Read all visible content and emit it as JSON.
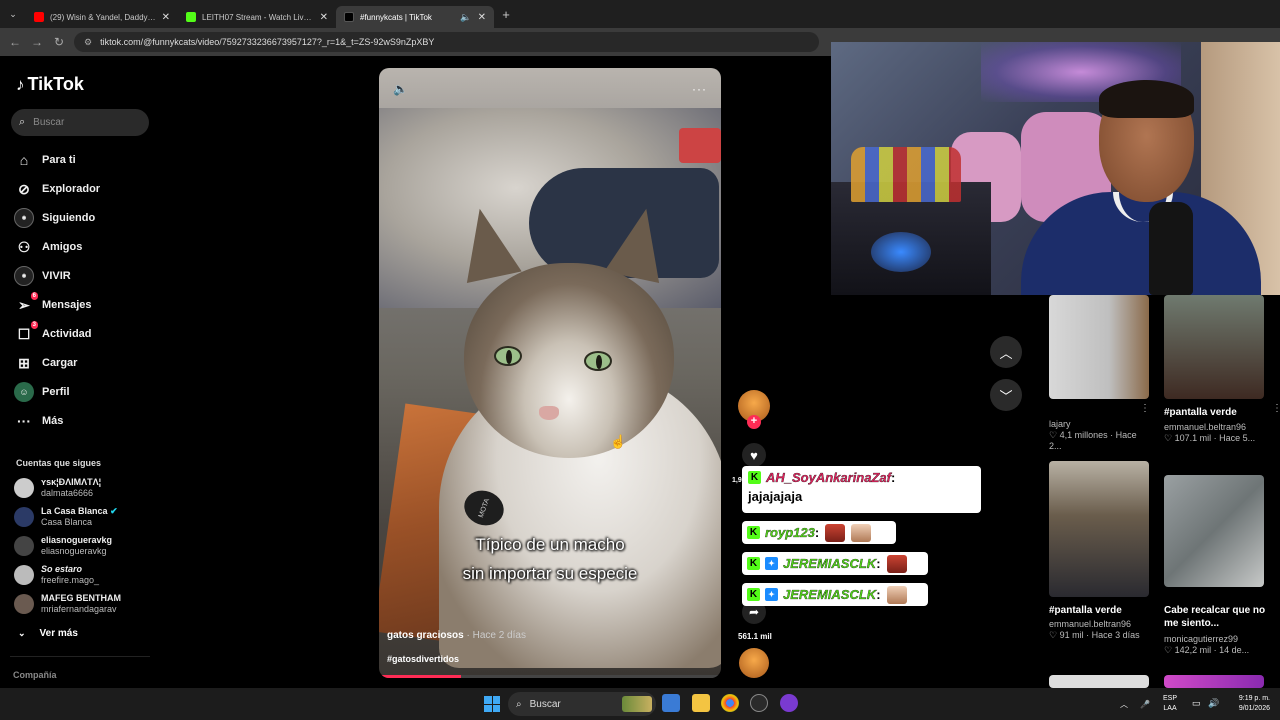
{
  "browser": {
    "tabs": [
      {
        "title": "(29) Wisin & Yandel, Daddy Yan",
        "favicon_color": "#ff0000",
        "active": false
      },
      {
        "title": "LEITH07 Stream - Watch Live o",
        "favicon_color": "#53fc18",
        "active": false
      },
      {
        "title": "#funnykcats | TikTok",
        "favicon_color": "#000000",
        "active": true
      }
    ],
    "new_tab_label": "+",
    "url": "tiktok.com/@funnykcats/video/7592733236673957127?_r=1&_t=ZS-92wS9nZpXBY"
  },
  "tiktok": {
    "logo": "TikTok",
    "search_placeholder": "Buscar",
    "nav": [
      {
        "label": "Para ti",
        "icon": "home-icon"
      },
      {
        "label": "Explorador",
        "icon": "compass-icon"
      },
      {
        "label": "Siguiendo",
        "icon": "following-icon"
      },
      {
        "label": "Amigos",
        "icon": "friends-icon"
      },
      {
        "label": "VIVIR",
        "icon": "live-icon"
      },
      {
        "label": "Mensajes",
        "icon": "messages-icon",
        "badge": "6"
      },
      {
        "label": "Actividad",
        "icon": "activity-icon",
        "badge": "3"
      },
      {
        "label": "Cargar",
        "icon": "upload-icon"
      },
      {
        "label": "Perfil",
        "icon": "profile-icon"
      },
      {
        "label": "Más",
        "icon": "more-icon"
      }
    ],
    "following_title": "Cuentas que sigues",
    "following": [
      {
        "name": "ʏsᴋ¦ĐΛIMΛTΛ¦",
        "handle": "dalmata6666"
      },
      {
        "name": "La Casa Blanca",
        "handle": "Casa Blanca",
        "verified": true
      },
      {
        "name": "eliasnogueravkg",
        "handle": "eliasnogueravkg"
      },
      {
        "name": "So estaro",
        "handle": "freefire.mago_"
      },
      {
        "name": "MAFEG BENTHAM",
        "handle": "mriafernandagarav"
      }
    ],
    "see_more": "Ver más",
    "company": "Compañía"
  },
  "video": {
    "caption_line1": "Típico de un macho",
    "caption_line2": "sin importar su especie",
    "author": "gatos graciosos",
    "ago": "· Hace 2 días",
    "hashtag": "#gatosdivertidos",
    "tag_text": "MOTA",
    "progress": 0.24,
    "like_count": "1,9",
    "share_count": "561.1 mil"
  },
  "chat": [
    {
      "user": "AH_SoyAnkarinaZaf",
      "sep": " :",
      "message": "jajajajaja",
      "color": "#e0245e"
    },
    {
      "user": "royp123",
      "sep": " :",
      "color": "#53d51a"
    },
    {
      "user": "JEREMIASCLK",
      "sep": " :",
      "color": "#53d51a"
    },
    {
      "user": "JEREMIASCLK",
      "sep": " :",
      "color": "#53d51a"
    }
  ],
  "recommendations": [
    {
      "title": "",
      "author": "lajary",
      "views": "4,1 millones",
      "ago": "· Hace 2..."
    },
    {
      "title": "#pantalla verde",
      "author": "emmanuel.beltran96",
      "views": "107.1 mil",
      "ago": "· Hace 5..."
    },
    {
      "title": "#pantalla verde",
      "author": "emmanuel.beltran96",
      "views": "91 mil",
      "ago": "· Hace 3 días"
    },
    {
      "title": "Cabe recalcar que no me siento...",
      "author": "monicagutierrez99",
      "views": "142,2 mil",
      "ago": "· 14 de..."
    }
  ],
  "taskbar": {
    "search_label": "Buscar",
    "lang_line1": "ESP",
    "lang_line2": "LAA",
    "time": "9:19 p. m.",
    "date": "9/01/2026"
  }
}
